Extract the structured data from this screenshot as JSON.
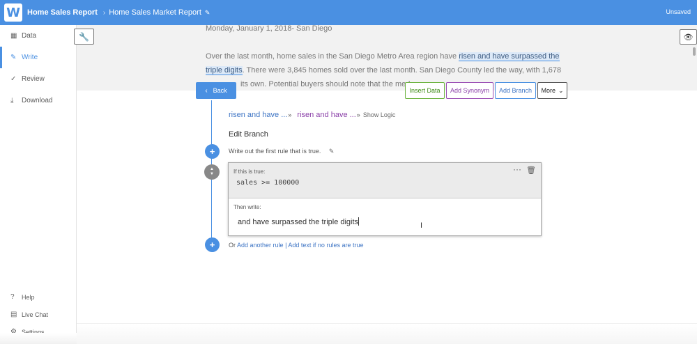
{
  "topbar": {
    "logo": "W",
    "app_title": "Home Sales Report",
    "separator": "›",
    "report_title": "Home Sales Market Report",
    "status": "Unsaved"
  },
  "sidebar": {
    "items": [
      {
        "label": "Data",
        "icon": "grid-icon",
        "active": false
      },
      {
        "label": "Write",
        "icon": "pencil-icon",
        "active": true
      },
      {
        "label": "Review",
        "icon": "checkmark-icon",
        "active": false
      },
      {
        "label": "Download",
        "icon": "download-icon",
        "active": false
      }
    ],
    "bottom": [
      {
        "label": "Help",
        "icon": "help-icon"
      },
      {
        "label": "Live Chat",
        "icon": "chat-icon"
      },
      {
        "label": "Settings",
        "icon": "gear-icon"
      }
    ]
  },
  "preview": {
    "date_line": "Monday, January 1, 2018- San Diego",
    "line1_before": "Over the last month, home sales in the San Diego Metro Area region have ",
    "line1_highlight": "risen and have surpassed the",
    "line2_highlight": "triple digits",
    "line2_after": ". There were 3,845 homes sold over the last month. San Diego County led the way, with 1,678",
    "line3": "its own. Potential buyers should note that the med"
  },
  "actions": {
    "back": "Back",
    "insert_data": "Insert Data",
    "add_synonym": "Add Synonym",
    "add_branch": "Add Branch",
    "more": "More"
  },
  "editor": {
    "crumb1": "risen and have ...",
    "crumb2": "risen and have ...",
    "crumb_sep": "»",
    "show_logic": "Show Logic",
    "title": "Edit Branch",
    "instruction": "Write out the first rule that is true.",
    "rule": {
      "if_label": "If this is true:",
      "condition": "sales >= 100000",
      "then_label": "Then write:",
      "then_text": "and have surpassed the triple digits"
    },
    "or_prefix": "Or ",
    "add_rule": "Add another rule",
    "divider": " | ",
    "add_default": "Add text if no rules are true"
  },
  "colors": {
    "accent": "#4a90e2",
    "insert_data": "#6cb33f",
    "add_synonym": "#9b4fb4"
  }
}
